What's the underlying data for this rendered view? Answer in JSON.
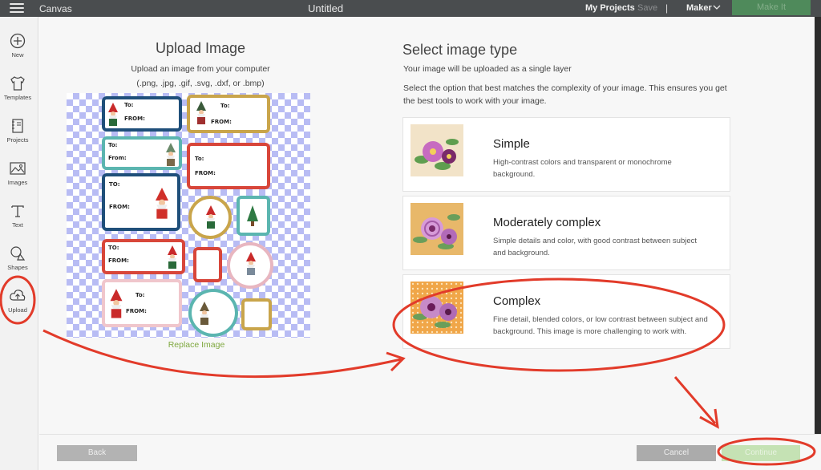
{
  "topbar": {
    "app_name": "Canvas",
    "doc_title": "Untitled",
    "my_projects": "My Projects",
    "save": "Save",
    "separator": "|",
    "machine": "Maker",
    "make_it": "Make It"
  },
  "sidebar": {
    "items": [
      {
        "label": "New",
        "icon": "plus-circle-icon"
      },
      {
        "label": "Templates",
        "icon": "shirt-icon"
      },
      {
        "label": "Projects",
        "icon": "notebook-icon"
      },
      {
        "label": "Images",
        "icon": "image-icon"
      },
      {
        "label": "Text",
        "icon": "text-t-icon"
      },
      {
        "label": "Shapes",
        "icon": "shapes-icon"
      },
      {
        "label": "Upload",
        "icon": "cloud-upload-icon"
      }
    ]
  },
  "upload": {
    "title": "Upload Image",
    "subtitle": "Upload an image from your computer",
    "formats": "(.png, .jpg, .gif, .svg, .dxf, or .bmp)",
    "replace": "Replace Image",
    "tag_to": "To:",
    "tag_from": "From:",
    "tag_to_upper": "TO:",
    "tag_from_upper": "FROM:"
  },
  "select": {
    "title": "Select image type",
    "subtitle": "Your image will be uploaded as a single layer",
    "description": "Select the option that best matches the complexity of your image. This ensures you get the best tools to work with your image.",
    "options": [
      {
        "title": "Simple",
        "description": "High-contrast colors and transparent or monochrome background."
      },
      {
        "title": "Moderately complex",
        "description": "Simple details and color, with good contrast between subject and background."
      },
      {
        "title": "Complex",
        "description": "Fine detail, blended colors, or low contrast between subject and background. This image is more challenging to work with."
      }
    ]
  },
  "footer": {
    "back": "Back",
    "cancel": "Cancel",
    "continue": "Continue"
  },
  "colors": {
    "annotation_red": "#e23b2a",
    "accent_green": "#7fa83f",
    "topbar": "#4a4d4f"
  }
}
